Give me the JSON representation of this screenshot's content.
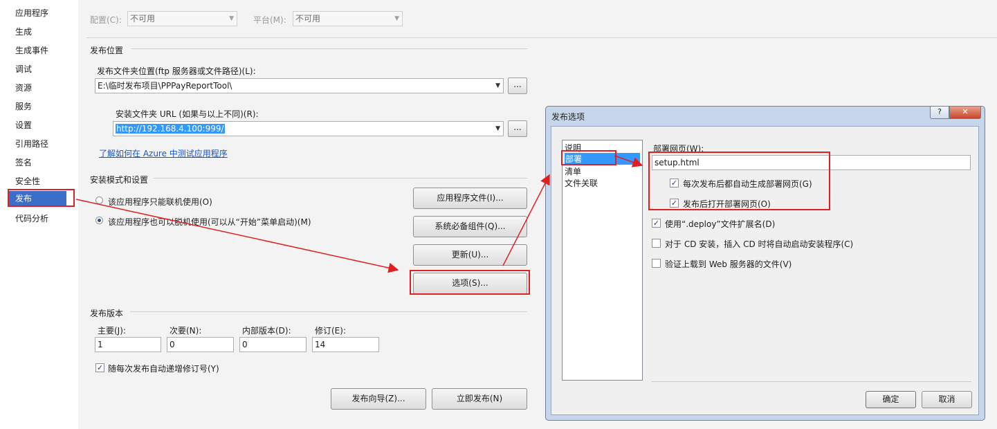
{
  "nav": {
    "items": [
      "应用程序",
      "生成",
      "生成事件",
      "调试",
      "资源",
      "服务",
      "设置",
      "引用路径",
      "签名",
      "安全性",
      "发布",
      "代码分析"
    ],
    "selected_index": 10
  },
  "toolbar": {
    "config_label": "配置(C):",
    "config_value": "不可用",
    "platform_label": "平台(M):",
    "platform_value": "不可用"
  },
  "publish_location": {
    "title": "发布位置",
    "folder_label": "发布文件夹位置(ftp 服务器或文件路径)(L):",
    "folder_value": "E:\\临时发布项目\\PPPayReportTool\\",
    "browse_label": "...",
    "install_url_label": "安装文件夹 URL (如果与以上不同)(R):",
    "install_url_value": "http://192.168.4.100:999/",
    "azure_link": "了解如何在 Azure 中测试应用程序"
  },
  "install_mode": {
    "title": "安装模式和设置",
    "online_only": "该应用程序只能联机使用(O)",
    "offline_available": "该应用程序也可以脱机使用(可以从“开始”菜单启动)(M)",
    "selected": "offline_available",
    "buttons": {
      "app_files": "应用程序文件(I)...",
      "prerequisites": "系统必备组件(Q)...",
      "updates": "更新(U)...",
      "options": "选项(S)..."
    }
  },
  "publish_version": {
    "title": "发布版本",
    "major_label": "主要(J):",
    "major_value": "1",
    "minor_label": "次要(N):",
    "minor_value": "0",
    "build_label": "内部版本(D):",
    "build_value": "0",
    "revision_label": "修订(E):",
    "revision_value": "14",
    "auto_increment_label": "随每次发布自动递增修订号(Y)",
    "auto_increment_checked": true
  },
  "bottom_buttons": {
    "wizard": "发布向导(Z)...",
    "publish_now": "立即发布(N)"
  },
  "dialog": {
    "title": "发布选项",
    "help_button": "?",
    "close_button": "✕",
    "list_items": [
      "说明",
      "部署",
      "清单",
      "文件关联"
    ],
    "selected_list_index": 1,
    "deploy_page_label": "部署网页(W):",
    "deploy_page_value": "setup.html",
    "auto_generate_label": "每次发布后都自动生成部署网页(G)",
    "auto_generate_checked": true,
    "open_after_label": "发布后打开部署网页(O)",
    "open_after_checked": true,
    "use_deploy_ext_label": "使用“.deploy”文件扩展名(D)",
    "use_deploy_ext_checked": true,
    "cd_autorun_label": "对于 CD 安装，插入 CD 时将自动启动安装程序(C)",
    "cd_autorun_checked": false,
    "verify_upload_label": "验证上载到 Web 服务器的文件(V)",
    "verify_upload_checked": false,
    "ok": "确定",
    "cancel": "取消"
  },
  "colors": {
    "nav_selected": "#3b6ec9",
    "highlight": "#3399ff",
    "annotation_red": "#e02020",
    "link": "#1a56c2"
  }
}
